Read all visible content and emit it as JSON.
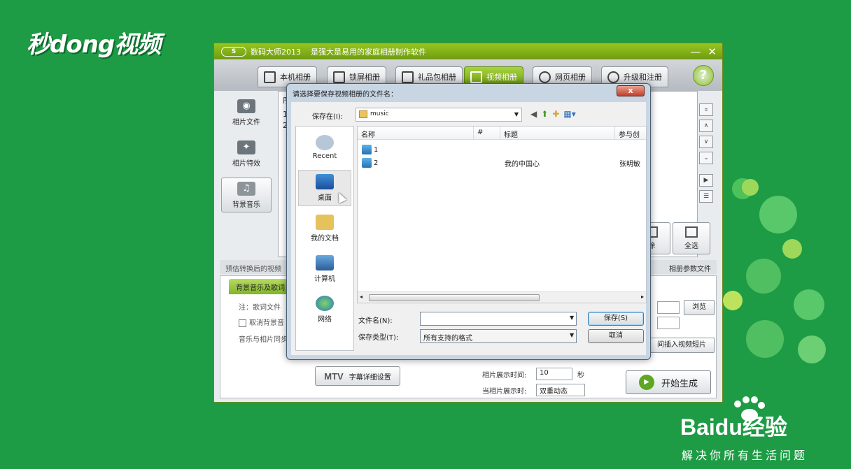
{
  "watermark": {
    "logo_text": "秒dong视频"
  },
  "baidu": {
    "brand": "Baidu经验",
    "slogan": "解决你所有生活问题"
  },
  "app": {
    "logo": "S",
    "title": "数码大师2013",
    "slogan": "是强大是易用的家庭相册制作软件",
    "minimize": "—",
    "close": "✕",
    "help": "?",
    "tabs": [
      {
        "label": "本机相册"
      },
      {
        "label": "锁屏相册"
      },
      {
        "label": "礼品包相册"
      },
      {
        "label": "视频相册"
      },
      {
        "label": "网页相册"
      },
      {
        "label": "升级和注册"
      }
    ],
    "leftnav": [
      {
        "label": "相片文件",
        "icon": "camera-icon"
      },
      {
        "label": "相片特效",
        "icon": "effects-icon"
      },
      {
        "label": "背景音乐",
        "icon": "music-note-icon"
      }
    ],
    "list_header_first": "序",
    "list_rows": [
      "1",
      "2"
    ],
    "right_buttons": [
      "⌅",
      "∧",
      "∨",
      "⌄",
      "▶",
      "☰"
    ],
    "big_buttons": [
      {
        "label": "除"
      },
      {
        "label": "全选"
      }
    ],
    "midbar_left": "预估转换后的视频",
    "midbar_right": "相册参数文件",
    "subtab": "背景音乐及歌词",
    "note": "注：歌词文件",
    "cancel_bgm": "取消背景音",
    "sync_text": "音乐与相片同步",
    "mtv_label": "MTV",
    "mtv_text": "字幕详细设置",
    "browse": "浏览",
    "insert_video": "间插入视频短片",
    "display_time_label": "相片展示时间:",
    "display_time_value": "10",
    "seconds": "秒",
    "when_display_label": "当相片展示时:",
    "when_display_value": "双重动态",
    "start": "开始生成"
  },
  "dialog": {
    "title": "请选择要保存视频相册的文件名：",
    "close": "x",
    "save_in_label": "保存在(I):",
    "save_in_value": "music",
    "places": [
      {
        "label": "Recent"
      },
      {
        "label": "桌面"
      },
      {
        "label": "我的文档"
      },
      {
        "label": "计算机"
      },
      {
        "label": "网络"
      }
    ],
    "columns": [
      "名称",
      "#",
      "标题",
      "参与创"
    ],
    "files": [
      {
        "name": "1",
        "num": "",
        "title": "",
        "artist": ""
      },
      {
        "name": "2",
        "num": "",
        "title": "我的中国心",
        "artist": "张明敏"
      }
    ],
    "filename_label": "文件名(N):",
    "filename_value": "",
    "filetype_label": "保存类型(T):",
    "filetype_value": "所有支持的格式",
    "save_btn": "保存(S)",
    "cancel_btn": "取消"
  }
}
